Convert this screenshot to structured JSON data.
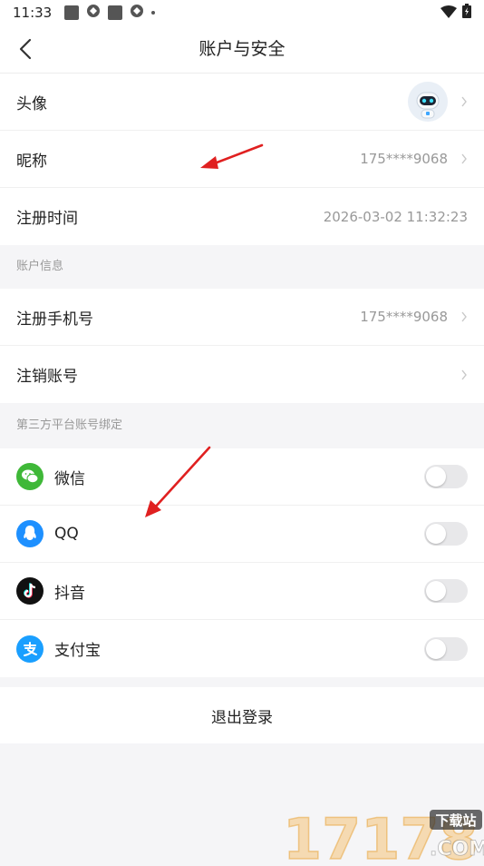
{
  "status_bar": {
    "time": "11:33"
  },
  "nav": {
    "title": "账户与安全"
  },
  "profile": {
    "avatar_label": "头像",
    "nickname_label": "昵称",
    "nickname_value": "175****9068",
    "register_time_label": "注册时间",
    "register_time_value": "2026-03-02 11:32:23"
  },
  "account_info": {
    "section_title": "账户信息",
    "phone_label": "注册手机号",
    "phone_value": "175****9068",
    "cancel_label": "注销账号"
  },
  "third_party": {
    "section_title": "第三方平台账号绑定",
    "items": [
      {
        "label": "微信",
        "icon": "wechat-icon",
        "color": "#3fb838",
        "enabled": false
      },
      {
        "label": "QQ",
        "icon": "qq-icon",
        "color": "#1e90ff",
        "enabled": false
      },
      {
        "label": "抖音",
        "icon": "douyin-icon",
        "color": "#111111",
        "enabled": false
      },
      {
        "label": "支付宝",
        "icon": "alipay-icon",
        "color": "#1a9fff",
        "enabled": false
      }
    ]
  },
  "logout_label": "退出登录",
  "watermark": {
    "digits": "17178",
    "tag": "下载站",
    "domain": ".COM"
  }
}
